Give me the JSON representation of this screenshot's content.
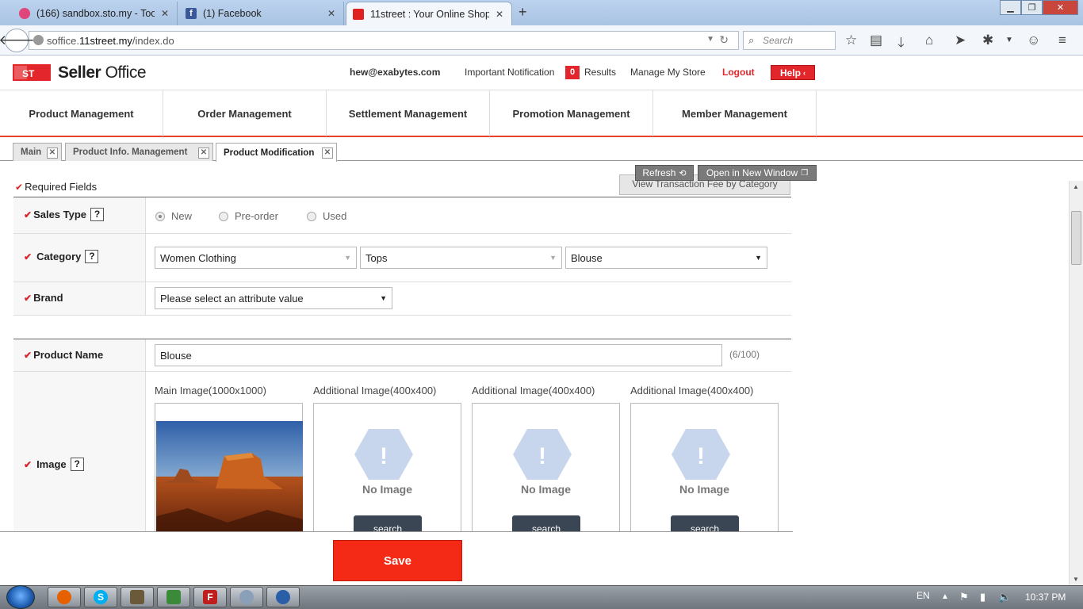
{
  "browser": {
    "tabs": [
      {
        "title": "(166) sandbox.sto.my - Tool",
        "icon": "sandbox-favicon"
      },
      {
        "title": "(1) Facebook",
        "icon": "facebook-favicon"
      },
      {
        "title": "11street : Your Online Shop...",
        "icon": "11street-favicon"
      }
    ],
    "url_prefix": "soffice.",
    "url_domain": "11street.my",
    "url_path": "/index.do",
    "search_placeholder": "Search"
  },
  "header": {
    "brand_bold": "Seller",
    "brand_light": "Office",
    "email": "hew@exabytes.com",
    "notification_label": "Important Notification",
    "notification_count": "0",
    "results_label": "Results",
    "manage_store": "Manage My Store",
    "logout": "Logout",
    "help": "Help"
  },
  "menu": [
    "Product Management",
    "Order Management",
    "Settlement Management",
    "Promotion Management",
    "Member Management"
  ],
  "page_tabs": [
    "Main",
    "Product Info. Management",
    "Product Modification"
  ],
  "toolbar": {
    "refresh": "Refresh",
    "open_new_window": "Open in New Window",
    "view_fee": "View Transaction Fee by Category"
  },
  "form": {
    "required_note": "Required Fields",
    "sales_type_label": "Sales Type",
    "sales_options": [
      "New",
      "Pre-order",
      "Used"
    ],
    "category_label": "Category",
    "category_values": [
      "Women Clothing",
      "Tops",
      "Blouse"
    ],
    "brand_label": "Brand",
    "brand_value": "Please select an attribute value",
    "product_name_label": "Product Name",
    "product_name_value": "Blouse",
    "product_name_count": "(6/100)",
    "image_label": "Image",
    "image_captions": [
      "Main Image(1000x1000)",
      "Additional Image(400x400)",
      "Additional Image(400x400)",
      "Additional Image(400x400)"
    ],
    "no_image": "No Image",
    "search_button": "search",
    "save": "Save"
  },
  "taskbar": {
    "lang": "EN",
    "time": "10:37 PM"
  },
  "colors": {
    "accent_red": "#e8412c",
    "save_red": "#f42a16",
    "checkmark": "#d9262b"
  }
}
